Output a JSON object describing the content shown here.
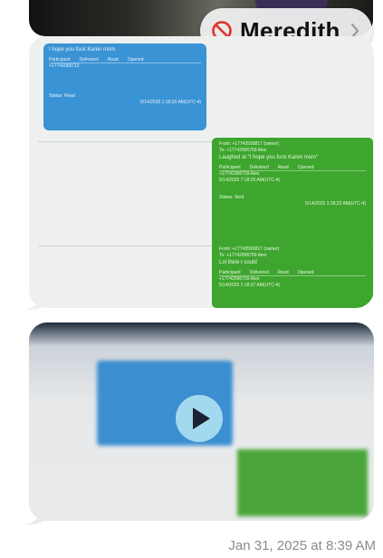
{
  "contact": {
    "name": "Meredith"
  },
  "message1": {
    "blue_card": {
      "title": "I hope you fuck Karen mom",
      "headers": [
        "Participant",
        "Delivered",
        "Read",
        "Opened"
      ],
      "participant": "+17742068713",
      "status": "Status: Read",
      "timestamp": "5/14/2025 1:18:33 AM(UTC-4)"
    },
    "green_card1": {
      "from": "From: +17743590817 (owner)",
      "to": "To: +17742006759 Alex",
      "body": "Laughed at \"I hope you fuck Karen mom\"",
      "headers": [
        "Participant",
        "Delivered",
        "Read",
        "Opened"
      ],
      "participant": "+17742006759 Alex",
      "delivered": "5/14/2025 7:18:25 AM(UTC-4)",
      "status": "Status: Sent",
      "timestamp": "5/14/2025 1:18:23 AM(UTC-4)"
    },
    "green_card2": {
      "from": "From: +17743590817 (owner)",
      "to": "To: +17742006759 Alex",
      "body": "Lol think I could",
      "headers": [
        "Participant",
        "Delivered",
        "Read",
        "Opened"
      ],
      "participant": "+17742006759 Alex",
      "delivered": "5/14/2025 1:18:37 AM(UTC-4)"
    }
  },
  "timestamp": "Jan 31, 2025 at 8:39 AM",
  "colors": {
    "blue_card": "#3a93d4",
    "green_card": "#3ea62e",
    "block_red": "#e0302c"
  }
}
